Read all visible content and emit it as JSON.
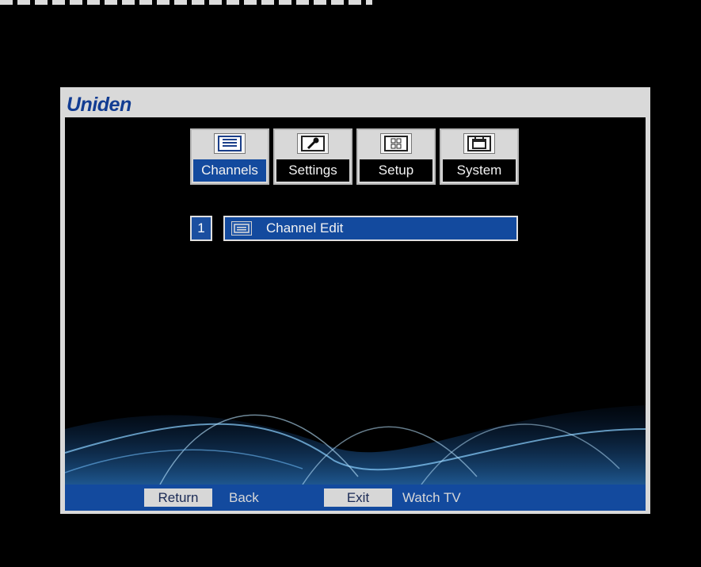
{
  "brand": {
    "name": "Uniden"
  },
  "tabs": [
    {
      "label": "Channels",
      "icon": "channel-list-icon",
      "active": true
    },
    {
      "label": "Settings",
      "icon": "wrench-icon",
      "active": false
    },
    {
      "label": "Setup",
      "icon": "grid-icon",
      "active": false
    },
    {
      "label": "System",
      "icon": "calendar-icon",
      "active": false
    }
  ],
  "menu": {
    "items": [
      {
        "index": "1",
        "label": "Channel Edit",
        "icon": "channel-edit-icon",
        "selected": true
      }
    ]
  },
  "footer": {
    "return_key": "Return",
    "return_desc": "Back",
    "exit_key": "Exit",
    "exit_desc": "Watch TV"
  },
  "colors": {
    "accent_blue": "#134a9e",
    "frame_gray": "#d9d9d9",
    "logo_blue": "#123c92"
  }
}
